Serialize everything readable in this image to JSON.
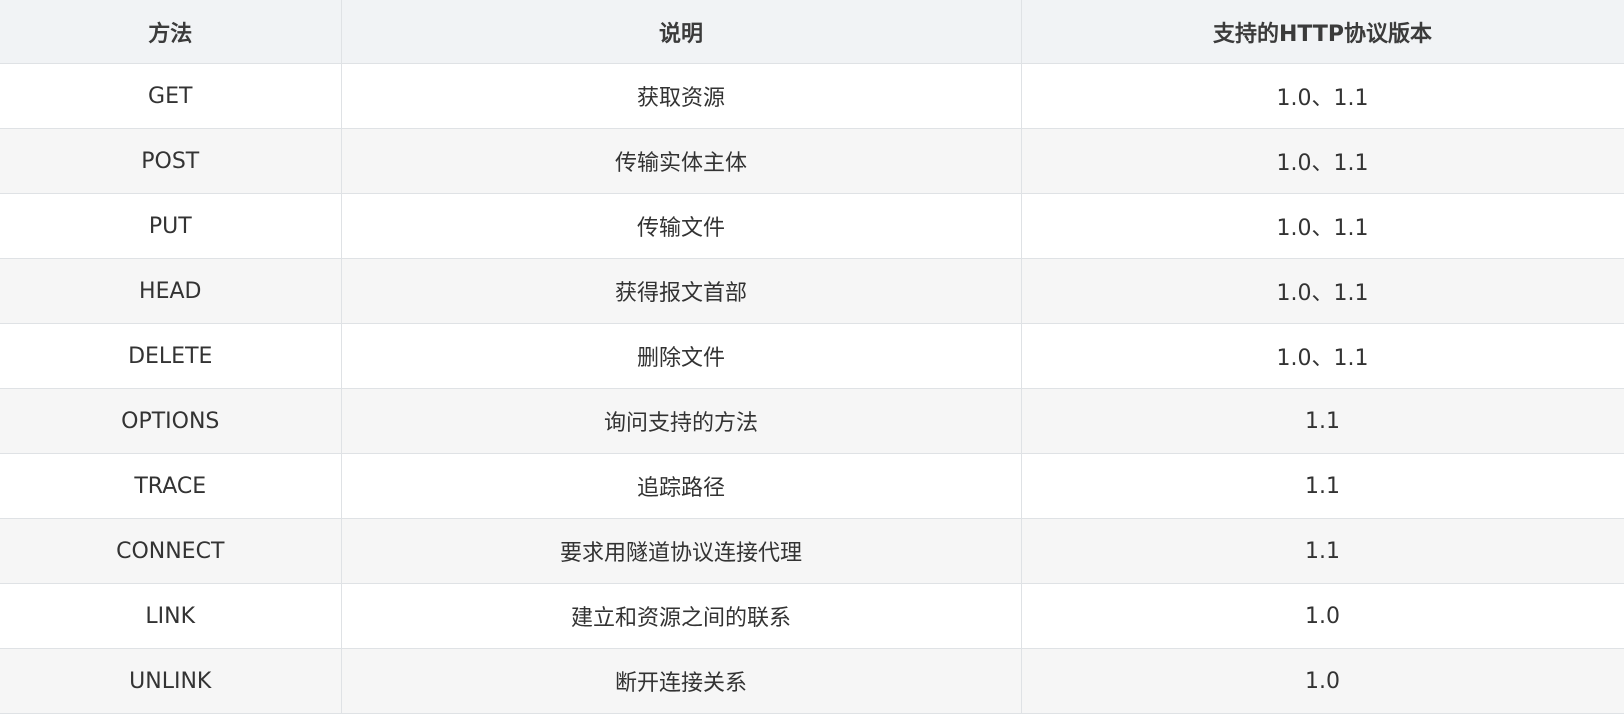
{
  "table": {
    "headers": [
      "方法",
      "说明",
      "支持的HTTP协议版本"
    ],
    "rows": [
      [
        "GET",
        "获取资源",
        "1.0、1.1"
      ],
      [
        "POST",
        "传输实体主体",
        "1.0、1.1"
      ],
      [
        "PUT",
        "传输文件",
        "1.0、1.1"
      ],
      [
        "HEAD",
        "获得报文首部",
        "1.0、1.1"
      ],
      [
        "DELETE",
        "删除文件",
        "1.0、1.1"
      ],
      [
        "OPTIONS",
        "询问支持的方法",
        "1.1"
      ],
      [
        "TRACE",
        "追踪路径",
        "1.1"
      ],
      [
        "CONNECT",
        "要求用隧道协议连接代理",
        "1.1"
      ],
      [
        "LINK",
        "建立和资源之间的联系",
        "1.0"
      ],
      [
        "UNLINK",
        "断开连接关系",
        "1.0"
      ]
    ]
  }
}
